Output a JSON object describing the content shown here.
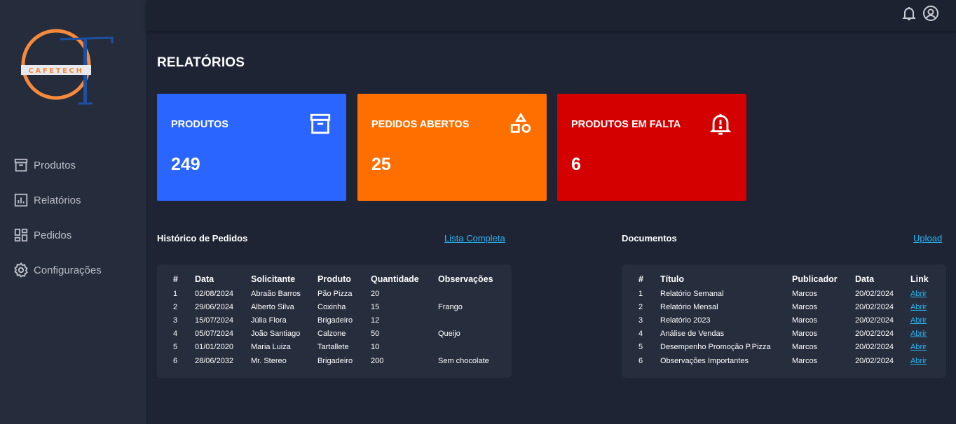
{
  "brand": {
    "logo_text": "CAFETECH",
    "colors": {
      "orange": "#f68a3c",
      "blue": "#1d4fa3"
    }
  },
  "sidebar": {
    "items": [
      {
        "label": "Produtos",
        "icon": "archive-icon"
      },
      {
        "label": "Relatórios",
        "icon": "bar-chart-icon"
      },
      {
        "label": "Pedidos",
        "icon": "dashboard-icon"
      },
      {
        "label": "Configurações",
        "icon": "gear-icon"
      }
    ]
  },
  "topbar": {
    "icons": [
      "bell-icon",
      "user-circle-icon"
    ]
  },
  "page": {
    "title": "RELATÓRIOS"
  },
  "cards": [
    {
      "label": "PRODUTOS",
      "value": "249",
      "color": "#2b65ff",
      "icon": "archive-icon"
    },
    {
      "label": "PEDIDOS ABERTOS",
      "value": "25",
      "color": "#ff6f00",
      "icon": "shapes-icon"
    },
    {
      "label": "PRODUTOS EM FALTA",
      "value": "6",
      "color": "#d40000",
      "icon": "bell-alert-icon"
    }
  ],
  "orders": {
    "title": "Histórico de Pedidos",
    "link": "Lista Completa",
    "headers": [
      "#",
      "Data",
      "Solicitante",
      "Produto",
      "Quantidade",
      "Observações"
    ],
    "rows": [
      [
        "1",
        "02/08/2024",
        "Abraão Barros",
        "Pão Pizza",
        "20",
        ""
      ],
      [
        "2",
        "29/06/2024",
        "Alberto Silva",
        "Coxinha",
        "15",
        "Frango"
      ],
      [
        "3",
        "15/07/2024",
        "Júlia Flora",
        "Brigadeiro",
        "12",
        ""
      ],
      [
        "4",
        "05/07/2024",
        "João Santiago",
        "Calzone",
        "50",
        "Queijo"
      ],
      [
        "5",
        "01/01/2020",
        "Maria Luiza",
        "Tartallete",
        "10",
        ""
      ],
      [
        "6",
        "28/06/2032",
        "Mr. Stereo",
        "Brigadeiro",
        "200",
        "Sem chocolate"
      ]
    ]
  },
  "documents": {
    "title": "Documentos",
    "link": "Upload",
    "headers": [
      "#",
      "Título",
      "Publicador",
      "Data",
      "Link"
    ],
    "rows": [
      [
        "1",
        "Relatório Semanal",
        "Marcos",
        "20/02/2024",
        "Abrir"
      ],
      [
        "2",
        "Relatório Mensal",
        "Marcos",
        "20/02/2024",
        "Abrir"
      ],
      [
        "3",
        "Relatório 2023",
        "Marcos",
        "20/02/2024",
        "Abrir"
      ],
      [
        "4",
        "Análise de Vendas",
        "Marcos",
        "20/02/2024",
        "Abrir"
      ],
      [
        "5",
        "Desempenho Promoção P.Pizza",
        "Marcos",
        "20/02/2024",
        "Abrir"
      ],
      [
        "6",
        "Observações Importantes",
        "Marcos",
        "20/02/2024",
        "Abrir"
      ]
    ]
  }
}
